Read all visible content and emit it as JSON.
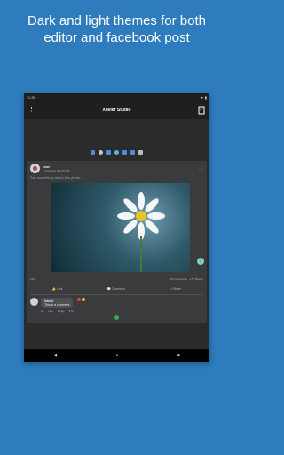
{
  "headline": {
    "line1": "Dark and light themes for both",
    "line2": "editor and facebook post"
  },
  "status_bar": {
    "time": "11:35"
  },
  "app_bar": {
    "title": "Xavier Studio"
  },
  "post": {
    "author": "Ivan",
    "subtitle": "· Yesterday at 6:00 PM",
    "caption": "Say something about this photo...",
    "reactions_count": "163",
    "comments_shares": "465 Comments · 172 Shares",
    "actions": {
      "like": "Like",
      "comment": "Comment",
      "share": "Share"
    }
  },
  "comment": {
    "author": "Xavier",
    "text": "This is a comment",
    "time": "1h",
    "like": "Like",
    "reply": "Reply",
    "reaction_count": "274"
  },
  "colors": {
    "background": "#2e7cbd",
    "device": "#2b2b2b",
    "accent_teal": "#7fd1c3"
  }
}
